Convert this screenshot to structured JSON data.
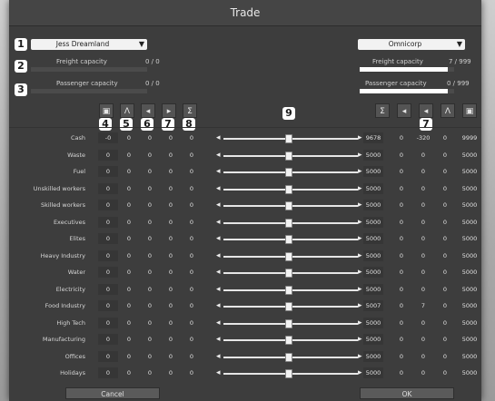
{
  "window": {
    "title": "Trade"
  },
  "left": {
    "company": "Jess Dreamland",
    "freight_label": "Freight capacity",
    "freight_value": "0 / 0",
    "freight_fill": 0,
    "passenger_label": "Passenger capacity",
    "passenger_value": "0 / 0",
    "passenger_fill": 0,
    "icons": [
      "import-icon",
      "chart-icon",
      "transfer-icon",
      "play-icon",
      "sum-icon"
    ]
  },
  "right": {
    "company": "Omnicorp",
    "freight_label": "Freight capacity",
    "freight_value": "7 / 999",
    "freight_fill": 0.93,
    "passenger_label": "Passenger capacity",
    "passenger_value": "0 / 999",
    "passenger_fill": 0.93,
    "icons": [
      "sum-icon",
      "play-reverse-icon",
      "transfer-icon",
      "chart-icon",
      "import-icon"
    ]
  },
  "badges": {
    "b1": "1",
    "b2": "2",
    "b3": "3",
    "b4": "4",
    "b5": "5",
    "b6": "6",
    "b7": "7",
    "b8": "8",
    "b9": "9",
    "b7r": "7"
  },
  "rows": [
    {
      "label": "Cash",
      "l": [
        "-0",
        "0",
        "0",
        "0",
        "0"
      ],
      "r": [
        "9678",
        "0",
        "-320",
        "0",
        "9999"
      ]
    },
    {
      "label": "Waste",
      "l": [
        "0",
        "0",
        "0",
        "0",
        "0"
      ],
      "r": [
        "5000",
        "0",
        "0",
        "0",
        "5000"
      ]
    },
    {
      "label": "Fuel",
      "l": [
        "0",
        "0",
        "0",
        "0",
        "0"
      ],
      "r": [
        "5000",
        "0",
        "0",
        "0",
        "5000"
      ]
    },
    {
      "label": "Unskilled workers",
      "l": [
        "0",
        "0",
        "0",
        "0",
        "0"
      ],
      "r": [
        "5000",
        "0",
        "0",
        "0",
        "5000"
      ]
    },
    {
      "label": "Skilled workers",
      "l": [
        "0",
        "0",
        "0",
        "0",
        "0"
      ],
      "r": [
        "5000",
        "0",
        "0",
        "0",
        "5000"
      ]
    },
    {
      "label": "Executives",
      "l": [
        "0",
        "0",
        "0",
        "0",
        "0"
      ],
      "r": [
        "5000",
        "0",
        "0",
        "0",
        "5000"
      ]
    },
    {
      "label": "Elites",
      "l": [
        "0",
        "0",
        "0",
        "0",
        "0"
      ],
      "r": [
        "5000",
        "0",
        "0",
        "0",
        "5000"
      ]
    },
    {
      "label": "Heavy Industry",
      "l": [
        "0",
        "0",
        "0",
        "0",
        "0"
      ],
      "r": [
        "5000",
        "0",
        "0",
        "0",
        "5000"
      ]
    },
    {
      "label": "Water",
      "l": [
        "0",
        "0",
        "0",
        "0",
        "0"
      ],
      "r": [
        "5000",
        "0",
        "0",
        "0",
        "5000"
      ]
    },
    {
      "label": "Electricity",
      "l": [
        "0",
        "0",
        "0",
        "0",
        "0"
      ],
      "r": [
        "5000",
        "0",
        "0",
        "0",
        "5000"
      ]
    },
    {
      "label": "Food Industry",
      "l": [
        "0",
        "0",
        "0",
        "0",
        "0"
      ],
      "r": [
        "5007",
        "0",
        "7",
        "0",
        "5000"
      ]
    },
    {
      "label": "High Tech",
      "l": [
        "0",
        "0",
        "0",
        "0",
        "0"
      ],
      "r": [
        "5000",
        "0",
        "0",
        "0",
        "5000"
      ]
    },
    {
      "label": "Manufacturing",
      "l": [
        "0",
        "0",
        "0",
        "0",
        "0"
      ],
      "r": [
        "5000",
        "0",
        "0",
        "0",
        "5000"
      ]
    },
    {
      "label": "Offices",
      "l": [
        "0",
        "0",
        "0",
        "0",
        "0"
      ],
      "r": [
        "5000",
        "0",
        "0",
        "0",
        "5000"
      ]
    },
    {
      "label": "Holidays",
      "l": [
        "0",
        "0",
        "0",
        "0",
        "0"
      ],
      "r": [
        "5000",
        "0",
        "0",
        "0",
        "5000"
      ]
    }
  ],
  "buttons": {
    "cancel": "Cancel",
    "ok": "OK"
  }
}
